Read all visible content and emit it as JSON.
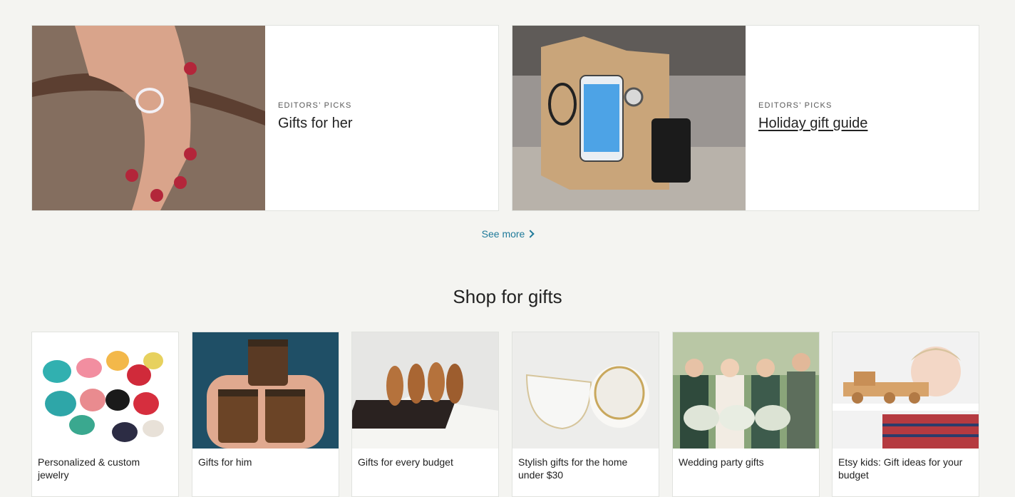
{
  "editors_picks": [
    {
      "kicker": "EDITORS’ PICKS",
      "title": "Gifts for her"
    },
    {
      "kicker": "EDITORS’ PICKS",
      "title": "Holiday gift guide"
    }
  ],
  "see_more": {
    "label": "See more"
  },
  "shop_for_gifts": {
    "title": "Shop for gifts",
    "tiles": [
      {
        "label": "Personalized & custom jewelry"
      },
      {
        "label": "Gifts for him"
      },
      {
        "label": "Gifts for every budget"
      },
      {
        "label": "Stylish gifts for the home under $30"
      },
      {
        "label": "Wedding party gifts"
      },
      {
        "label": "Etsy kids: Gift ideas for your budget"
      }
    ]
  },
  "colors": {
    "link": "#1f7a9a",
    "background": "#f4f4f1"
  }
}
